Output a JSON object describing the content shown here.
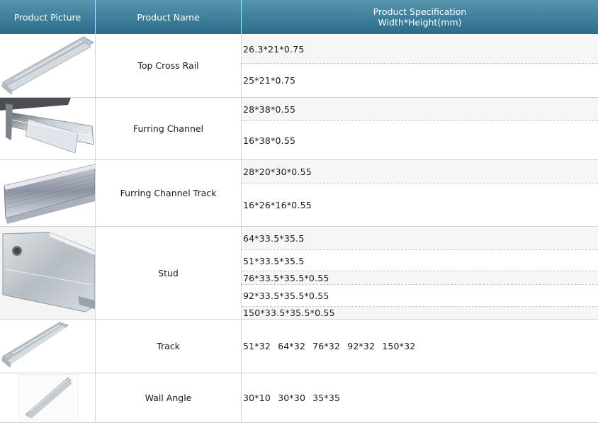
{
  "header": {
    "picture": "Product Picture",
    "name": "Product Name",
    "spec_line1": "Product Specification",
    "spec_line2": "Width*Height(mm)"
  },
  "products": [
    {
      "name": "Top Cross Rail",
      "image": "top-cross-rail-photo",
      "specs": [
        "26.3*21*0.75",
        "25*21*0.75"
      ]
    },
    {
      "name": "Furring Channel",
      "image": "furring-channel-photo",
      "specs": [
        "28*38*0.55",
        "16*38*0.55"
      ]
    },
    {
      "name": "Furring Channel Track",
      "image": "furring-channel-track-photo",
      "specs": [
        "28*20*30*0.55",
        "16*26*16*0.55"
      ]
    },
    {
      "name": "Stud",
      "image": "stud-photo",
      "specs": [
        "64*33.5*35.5",
        "51*33.5*35.5",
        "76*33.5*35.5*0.55",
        "92*33.5*35.5*0.55",
        "150*33.5*35.5*0.55"
      ]
    },
    {
      "name": "Track",
      "image": "track-photo",
      "specs": [
        "51*32",
        "64*32",
        "76*32",
        "92*32",
        "150*32"
      ]
    },
    {
      "name": "Wall Angle",
      "image": "wall-angle-photo",
      "specs": [
        "30*10",
        "30*30",
        "35*35"
      ]
    }
  ],
  "colors": {
    "header_top": "#5794ad",
    "header_bottom": "#2c6d8b",
    "header_text": "#ffffff",
    "grid": "#cfcfcf"
  }
}
